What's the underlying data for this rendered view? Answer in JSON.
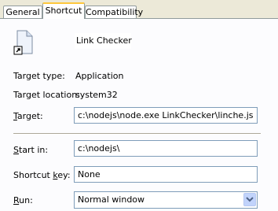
{
  "tabs": [
    {
      "label": "General"
    },
    {
      "label": "Shortcut"
    },
    {
      "label": "Compatibility"
    }
  ],
  "header": {
    "name": "Link Checker",
    "icon": "shortcut-file-icon"
  },
  "info": {
    "target_type_label": "Target type:",
    "target_type_value": "Application",
    "target_location_label": "Target location:",
    "target_location_value": "system32"
  },
  "target": {
    "label_pre": "",
    "label_key": "T",
    "label_post": "arget:",
    "value": "c:\\nodejs\\node.exe LinkChecker\\linche.js"
  },
  "start_in": {
    "label_pre": "",
    "label_key": "S",
    "label_post": "tart in:",
    "value": "c:\\nodejs\\"
  },
  "shortcut_key": {
    "label_pre": "Shortcut ",
    "label_key": "k",
    "label_post": "ey:",
    "value": "None"
  },
  "run": {
    "label_pre": "",
    "label_key": "R",
    "label_post": "un:",
    "value": "Normal window"
  },
  "colors": {
    "tab_highlight": "#ffc83c",
    "panel": "#fcfcfe",
    "field_border": "#7f9db9"
  }
}
